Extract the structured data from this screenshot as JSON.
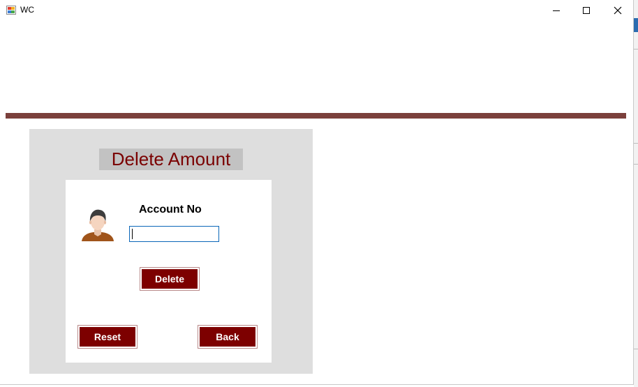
{
  "window": {
    "title": "WC",
    "controls": {
      "minimize": "minimize-icon",
      "maximize": "maximize-icon",
      "close": "close-icon"
    }
  },
  "colors": {
    "divider": "#7b403c",
    "panel_bg": "#dedede",
    "title_bg": "#c2c2c2",
    "title_text": "#7a0000",
    "button_bg": "#7d0000",
    "button_text": "#ffffff",
    "input_border": "#0a66b8"
  },
  "form": {
    "heading": "Delete Amount",
    "avatar_icon": "user-avatar-icon",
    "account_label": "Account No",
    "account_value": "",
    "delete_label": "Delete",
    "reset_label": "Reset",
    "back_label": "Back"
  }
}
